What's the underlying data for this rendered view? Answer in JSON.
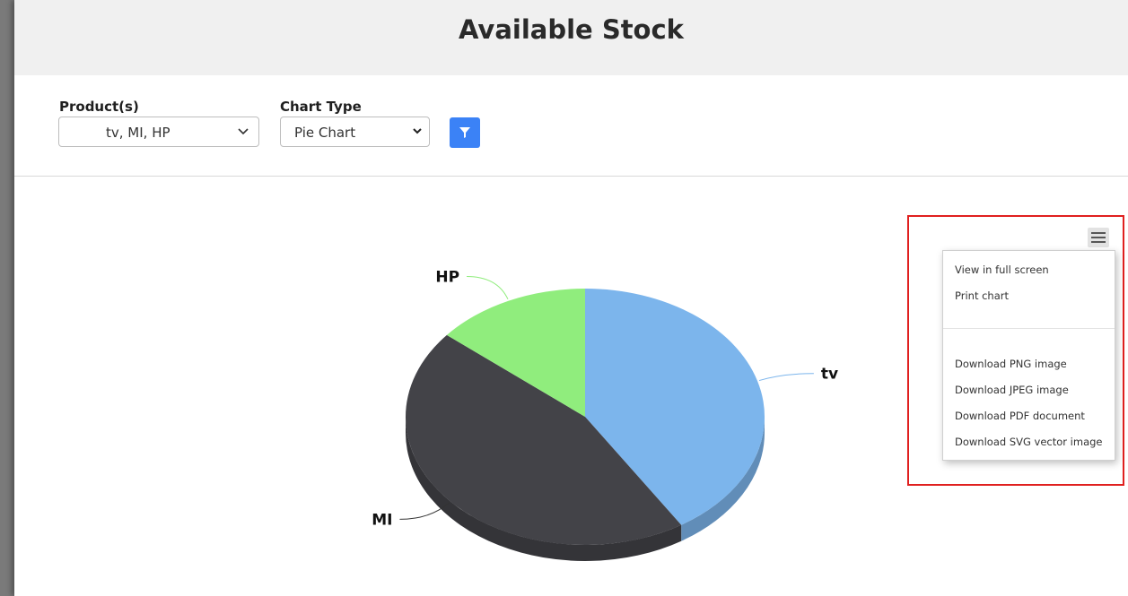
{
  "page": {
    "title": "Available Stock"
  },
  "filters": {
    "products_label": "Product(s)",
    "products_value": "tv, MI, HP",
    "chart_type_label": "Chart Type",
    "chart_type_value": "Pie Chart",
    "filter_button_icon": "filter-icon"
  },
  "colors": {
    "accent": "#3b82f6",
    "highlight": "#e0201f"
  },
  "chart_data": {
    "type": "pie",
    "categories": [
      "tv",
      "MI",
      "HP"
    ],
    "values": [
      41,
      45,
      14
    ],
    "colors": [
      "#7cb5ec",
      "#434348",
      "#90ed7d"
    ],
    "style": "3d"
  },
  "export_menu": {
    "button_icon": "hamburger-menu-icon",
    "items": [
      "View in full screen",
      "Print chart",
      "Download PNG image",
      "Download JPEG image",
      "Download PDF document",
      "Download SVG vector image"
    ]
  }
}
